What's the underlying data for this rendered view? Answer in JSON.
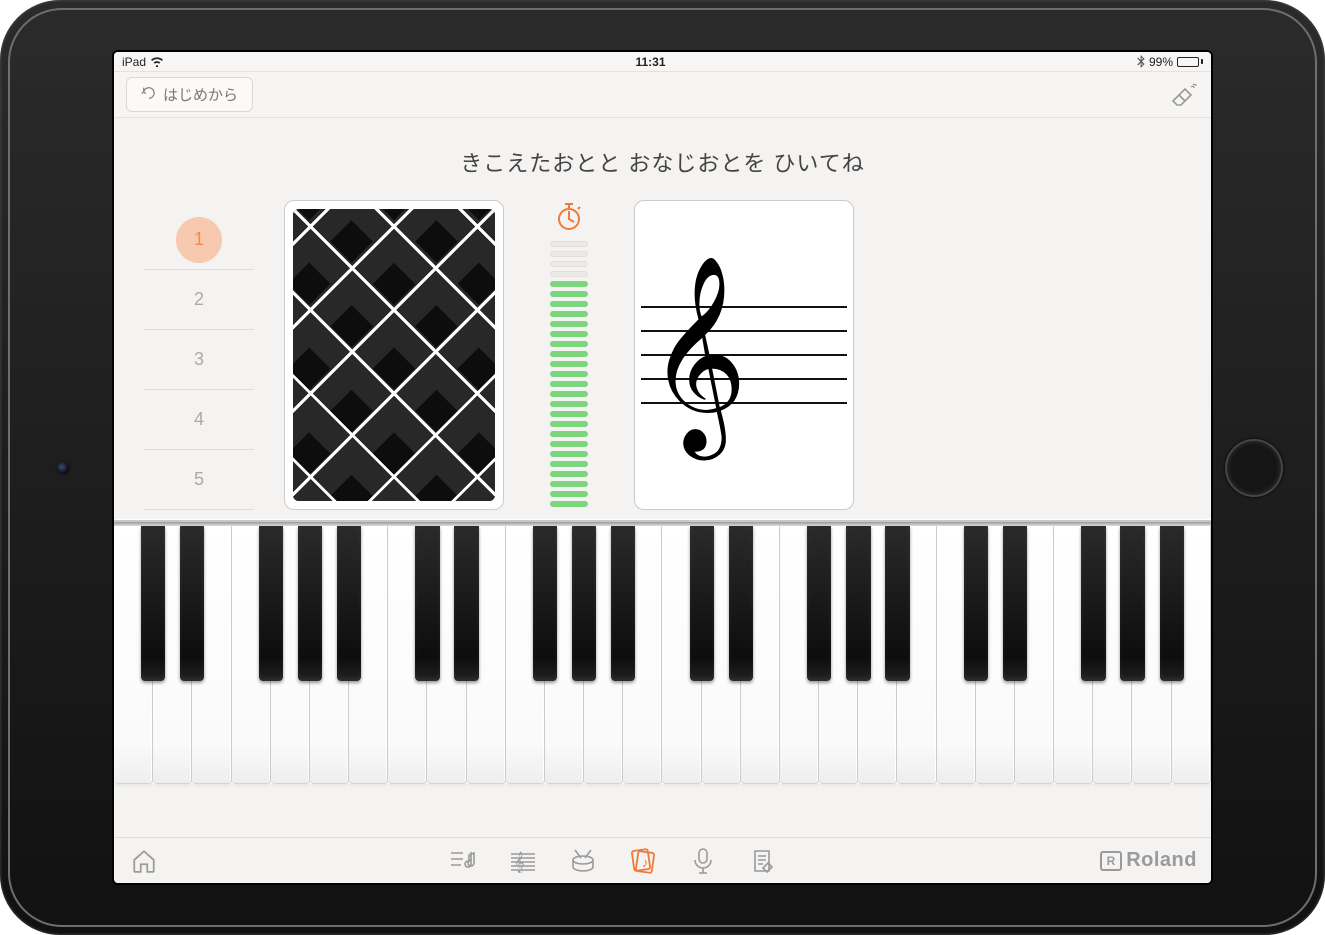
{
  "status": {
    "device": "iPad",
    "time": "11:31",
    "battery_pct": "99%"
  },
  "toolbar": {
    "restart_label": "はじめから"
  },
  "instruction": "きこえたおとと おなじおとを ひいてね",
  "steps": {
    "items": [
      "1",
      "2",
      "3",
      "4",
      "5"
    ],
    "active_index": 0
  },
  "timer": {
    "total_bars": 27,
    "elapsed_off_bars": 4
  },
  "piano": {
    "white_keys": 28,
    "octaves": 4
  },
  "brand": {
    "name": "Roland",
    "badge": "R"
  },
  "bottom_nav": {
    "icons": [
      "home",
      "playlist",
      "score",
      "drum",
      "flashcard",
      "mic",
      "write"
    ],
    "active": "flashcard"
  }
}
